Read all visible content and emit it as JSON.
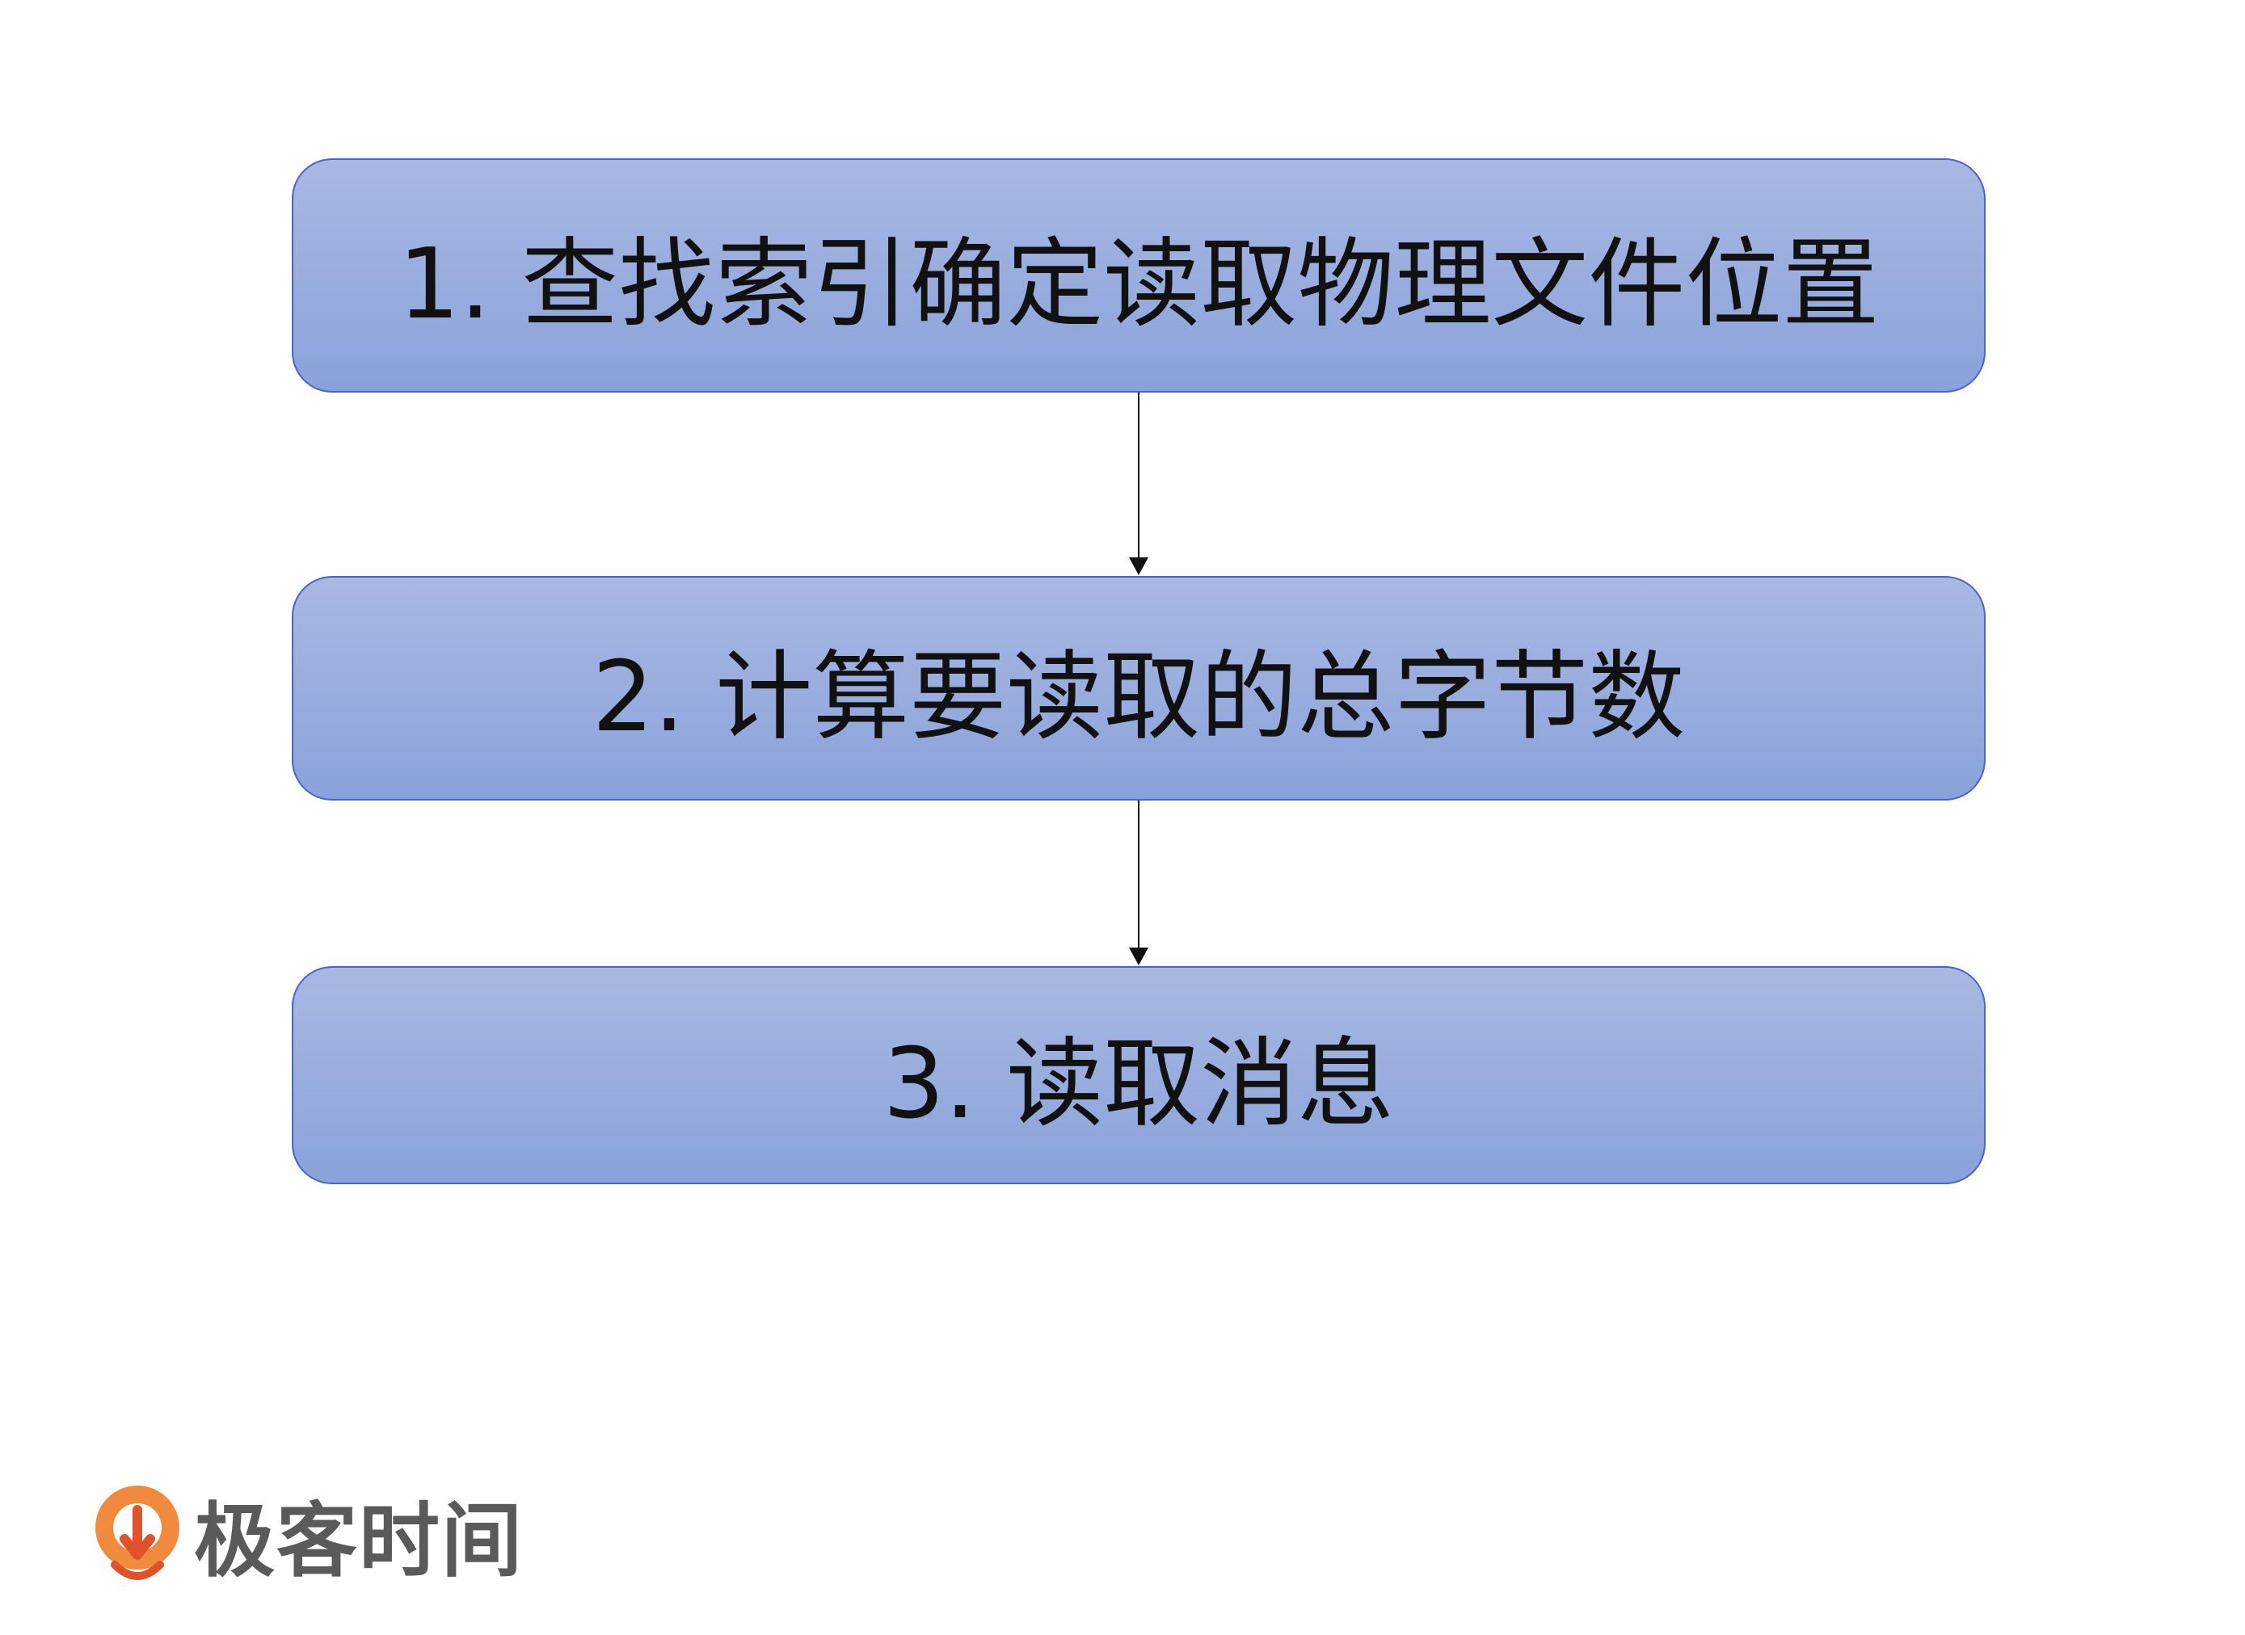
{
  "steps": [
    {
      "label": "1. 查找索引确定读取物理文件位置"
    },
    {
      "label": "2. 计算要读取的总字节数"
    },
    {
      "label": "3. 读取消息"
    }
  ],
  "logo": {
    "text": "极客时间",
    "icon": "geektime-logo-icon",
    "colors": {
      "outer": "#f08a3c",
      "inner": "#e0522a"
    }
  },
  "colors": {
    "box_fill_top": "#a9b8e2",
    "box_fill_bottom": "#8aa2da",
    "box_border": "#4a63c8",
    "arrow": "#111111"
  }
}
